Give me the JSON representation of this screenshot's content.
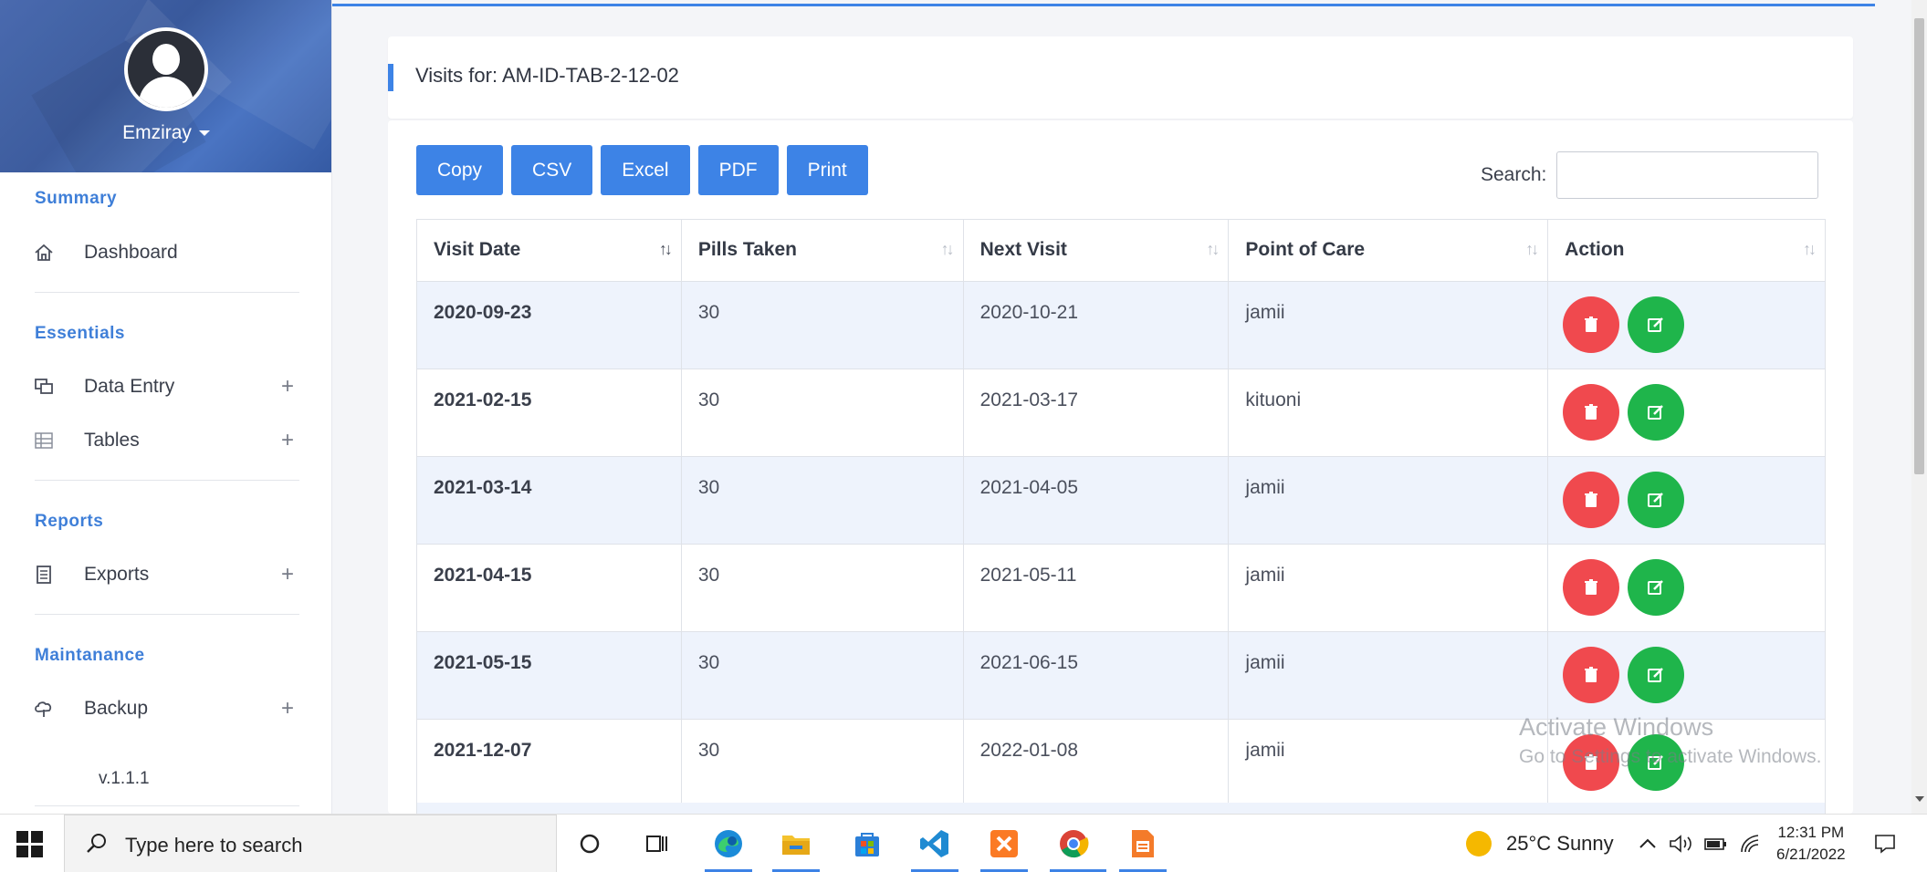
{
  "sidebar": {
    "username": "Emziray",
    "sections": {
      "summary": "Summary",
      "essentials": "Essentials",
      "reports": "Reports",
      "maintenance": "Maintanance"
    },
    "items": {
      "dashboard": "Dashboard",
      "data_entry": "Data Entry",
      "tables": "Tables",
      "exports": "Exports",
      "backup": "Backup"
    },
    "expand_symbol": "+",
    "version": "v.1.1.1"
  },
  "card": {
    "title": "Visits for: AM-ID-TAB-2-12-02"
  },
  "toolbar": {
    "copy": "Copy",
    "csv": "CSV",
    "excel": "Excel",
    "pdf": "PDF",
    "print": "Print",
    "search_label": "Search:",
    "search_value": ""
  },
  "table": {
    "columns": [
      "Visit Date",
      "Pills Taken",
      "Next Visit",
      "Point of Care",
      "Action"
    ],
    "sort_glyph": "↑↓",
    "rows": [
      {
        "visit_date": "2020-09-23",
        "pills": "30",
        "next_visit": "2020-10-21",
        "point_of_care": "jamii"
      },
      {
        "visit_date": "2021-02-15",
        "pills": "30",
        "next_visit": "2021-03-17",
        "point_of_care": "kituoni"
      },
      {
        "visit_date": "2021-03-14",
        "pills": "30",
        "next_visit": "2021-04-05",
        "point_of_care": "jamii"
      },
      {
        "visit_date": "2021-04-15",
        "pills": "30",
        "next_visit": "2021-05-11",
        "point_of_care": "jamii"
      },
      {
        "visit_date": "2021-05-15",
        "pills": "30",
        "next_visit": "2021-06-15",
        "point_of_care": "jamii"
      },
      {
        "visit_date": "2021-12-07",
        "pills": "30",
        "next_visit": "2022-01-08",
        "point_of_care": "jamii"
      }
    ]
  },
  "watermark": {
    "line1": "Activate Windows",
    "line2": "Go to Settings to activate Windows."
  },
  "taskbar": {
    "search_placeholder": "Type here to search",
    "weather": "25°C  Sunny",
    "time": "12:31 PM",
    "date": "6/21/2022"
  },
  "colors": {
    "accent": "#3d83e6",
    "delete": "#f0494e",
    "edit": "#1fb54b",
    "section_title": "#3f7fd8",
    "row_stripe": "#eef3fc"
  }
}
